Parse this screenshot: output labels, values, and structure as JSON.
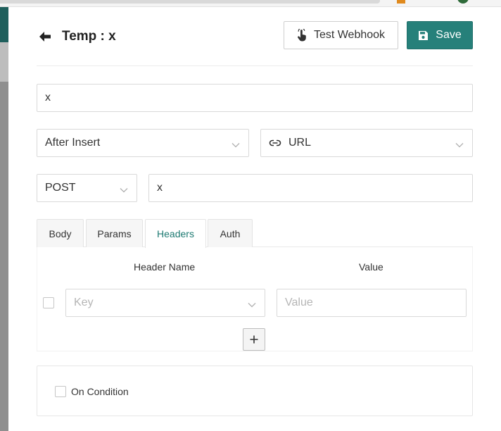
{
  "header": {
    "title": "Temp : x",
    "test_webhook_label": "Test Webhook",
    "save_label": "Save"
  },
  "form": {
    "title_value": "x",
    "event_value": "After Insert",
    "notification_type_value": "URL",
    "method_value": "POST",
    "url_value": "x"
  },
  "tabs": [
    {
      "label": "Body",
      "active": false
    },
    {
      "label": "Params",
      "active": false
    },
    {
      "label": "Headers",
      "active": true
    },
    {
      "label": "Auth",
      "active": false
    }
  ],
  "headers_table": {
    "columns": [
      "Header Name",
      "Value"
    ],
    "rows": [
      {
        "checked": false,
        "key_placeholder": "Key",
        "value_placeholder": "Value"
      }
    ]
  },
  "condition": {
    "label": "On Condition",
    "checked": false
  },
  "colors": {
    "accent": "#26807a",
    "active_tab_text": "#1d7a72"
  }
}
